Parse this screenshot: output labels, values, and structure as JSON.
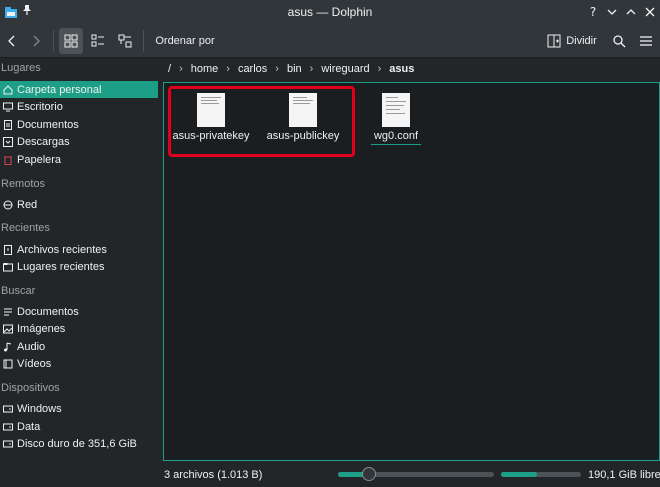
{
  "window": {
    "title": "asus — Dolphin"
  },
  "toolbar": {
    "sort_label": "Ordenar por",
    "split_label": "Dividir"
  },
  "sidebar": {
    "sections": [
      {
        "label": "Lugares",
        "items": [
          {
            "label": "Carpeta personal",
            "icon": "home-icon",
            "selected": true
          },
          {
            "label": "Escritorio",
            "icon": "desktop-icon"
          },
          {
            "label": "Documentos",
            "icon": "documents-icon"
          },
          {
            "label": "Descargas",
            "icon": "downloads-icon"
          },
          {
            "label": "Papelera",
            "icon": "trash-icon"
          }
        ]
      },
      {
        "label": "Remotos",
        "items": [
          {
            "label": "Red",
            "icon": "network-icon"
          }
        ]
      },
      {
        "label": "Recientes",
        "items": [
          {
            "label": "Archivos recientes",
            "icon": "recent-files-icon"
          },
          {
            "label": "Lugares recientes",
            "icon": "recent-places-icon"
          }
        ]
      },
      {
        "label": "Buscar",
        "items": [
          {
            "label": "Documentos",
            "icon": "search-documents-icon"
          },
          {
            "label": "Imágenes",
            "icon": "images-icon"
          },
          {
            "label": "Audio",
            "icon": "audio-icon"
          },
          {
            "label": "Vídeos",
            "icon": "videos-icon"
          }
        ]
      },
      {
        "label": "Dispositivos",
        "items": [
          {
            "label": "Windows",
            "icon": "drive-icon"
          },
          {
            "label": "Data",
            "icon": "drive-icon"
          },
          {
            "label": "Disco duro de 351,6 GiB",
            "icon": "drive-icon"
          }
        ]
      }
    ]
  },
  "breadcrumb": [
    "/",
    "home",
    "carlos",
    "bin",
    "wireguard",
    "asus"
  ],
  "files": [
    {
      "name": "asus-privatekey"
    },
    {
      "name": "asus-publickey"
    },
    {
      "name": "wg0.conf"
    }
  ],
  "status": {
    "summary": "3 archivos (1.013 B)",
    "zoom_fraction": 0.2,
    "free_space": "190,1 GiB libre",
    "used_fraction": 0.45
  },
  "colors": {
    "accent": "#1d9f87",
    "highlight": "#e0001b",
    "background": "#232629"
  }
}
